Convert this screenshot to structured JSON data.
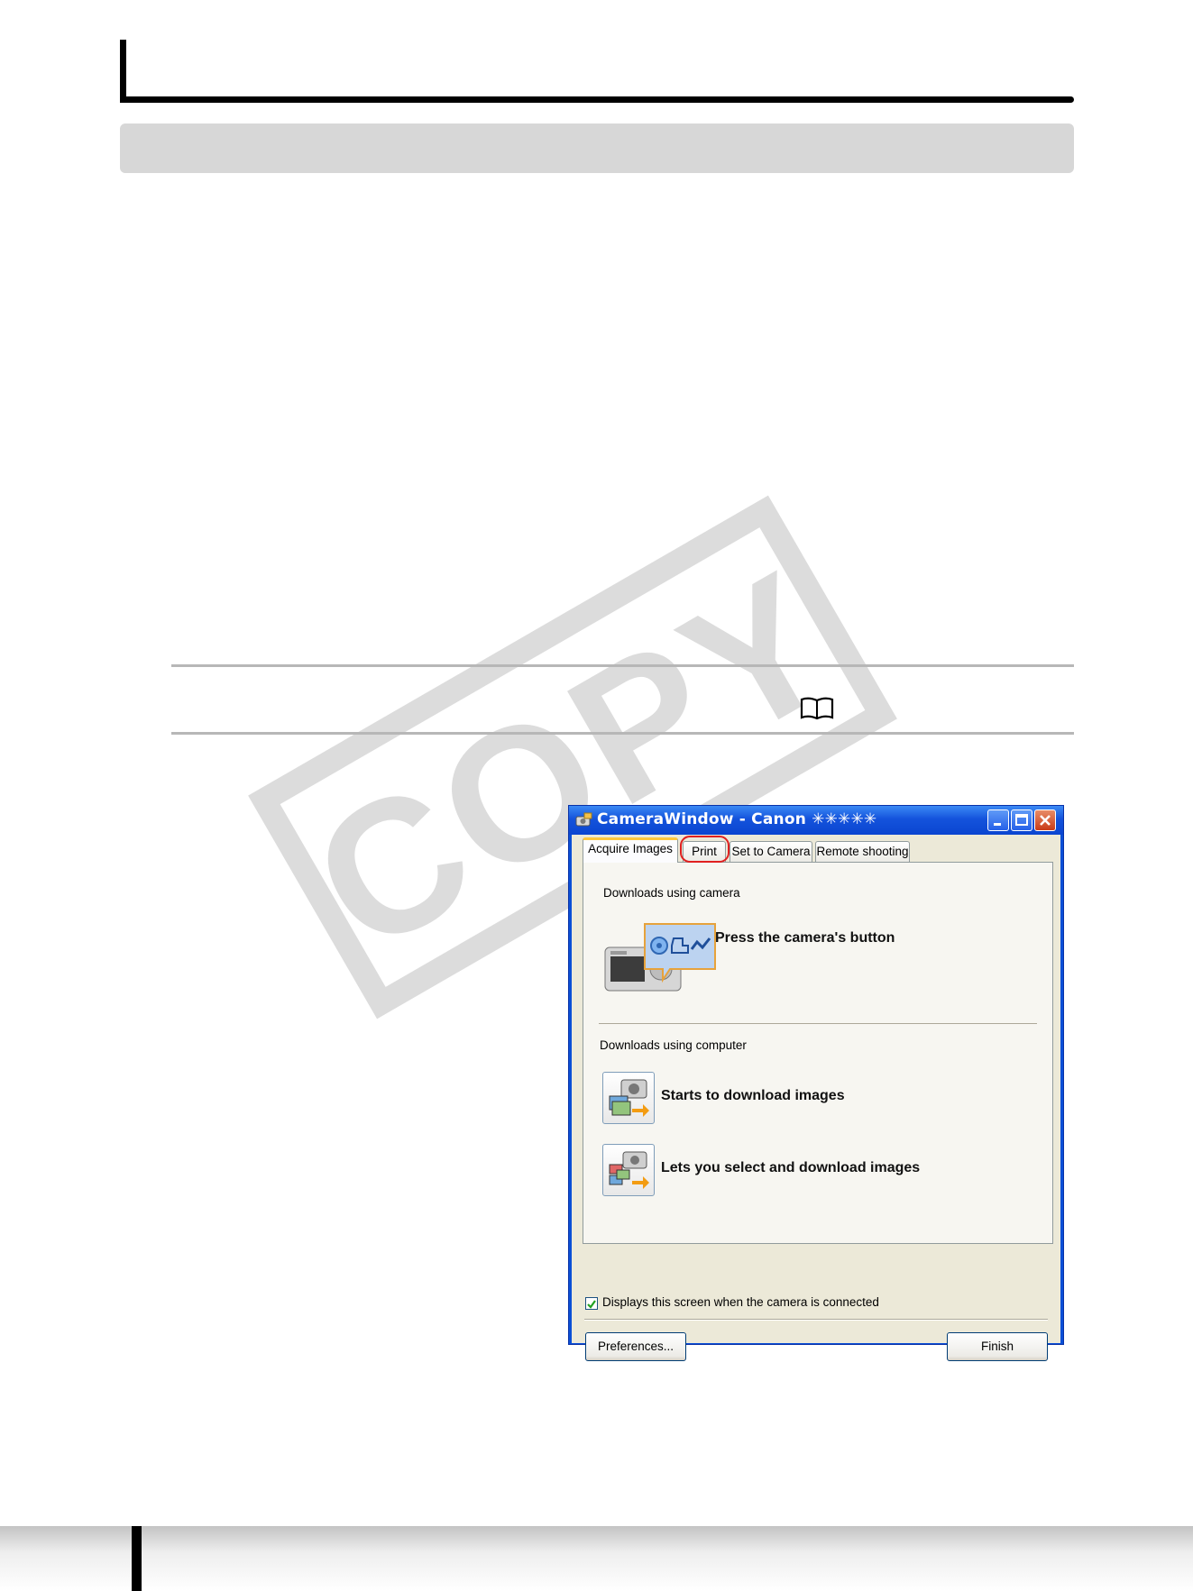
{
  "watermark": {
    "text": "COPY"
  },
  "window": {
    "title": "CameraWindow - Canon ✳✳✳✳✳",
    "tabs": [
      {
        "label": "Acquire Images",
        "active": true
      },
      {
        "label": "Print",
        "highlighted": true
      },
      {
        "label": "Set to Camera"
      },
      {
        "label": "Remote shooting"
      }
    ],
    "camera_section": {
      "label": "Downloads using camera",
      "action": "Press the camera's button"
    },
    "computer_section": {
      "label": "Downloads using computer",
      "actions": [
        {
          "label": "Starts to download images",
          "icon": "download-all-icon"
        },
        {
          "label": "Lets you select and download images",
          "icon": "select-download-icon"
        }
      ]
    },
    "checkbox": {
      "label": "Displays this screen when the camera is connected",
      "checked": true
    },
    "buttons": {
      "preferences": "Preferences...",
      "finish": "Finish"
    }
  },
  "colors": {
    "titlebar": "#0a4fd6",
    "highlight_ring": "#e02020",
    "watermark": "#dcdcdc"
  },
  "icons": [
    "book-icon",
    "minimize-icon",
    "maximize-icon",
    "close-icon"
  ]
}
